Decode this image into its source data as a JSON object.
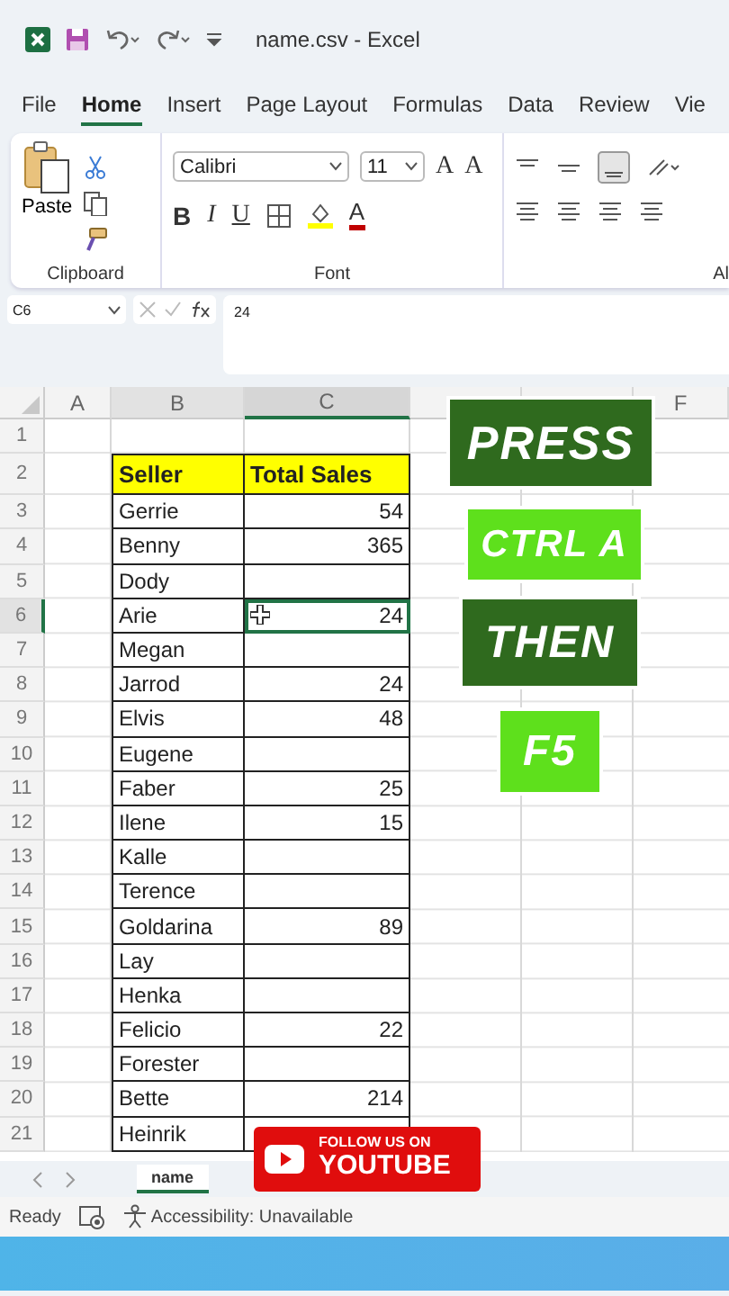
{
  "title_bar": {
    "file_name": "name.csv",
    "separator": "-",
    "app": "Excel"
  },
  "ribbon_tabs": [
    {
      "label": "File",
      "selected": false
    },
    {
      "label": "Home",
      "selected": true
    },
    {
      "label": "Insert",
      "selected": false
    },
    {
      "label": "Page Layout",
      "selected": false
    },
    {
      "label": "Formulas",
      "selected": false
    },
    {
      "label": "Data",
      "selected": false
    },
    {
      "label": "Review",
      "selected": false
    },
    {
      "label": "Vie",
      "selected": false
    }
  ],
  "clipboard": {
    "paste_label": "Paste",
    "group_label": "Clipboard"
  },
  "font": {
    "font_name": "Calibri",
    "font_size": "11",
    "grow_label": "A",
    "shrink_label": "A",
    "bold_label": "B",
    "italic_label": "I",
    "underline_label": "U",
    "color_label": "A",
    "group_label": "Font"
  },
  "alignment": {
    "group_label": "Al"
  },
  "formula_bar": {
    "cell_ref": "C6",
    "value": "24"
  },
  "columns": [
    {
      "label": "A",
      "selected": false
    },
    {
      "label": "B",
      "selected": false
    },
    {
      "label": "C",
      "selected": true
    }
  ],
  "last_column": "F",
  "rows": [
    {
      "number": "1",
      "kind": "empty"
    },
    {
      "number": "2",
      "kind": "header",
      "seller": "Seller",
      "sales": "Total Sales"
    },
    {
      "number": "3",
      "kind": "data",
      "seller": "Gerrie",
      "sales": "54",
      "selected": false
    },
    {
      "number": "4",
      "kind": "data",
      "seller": "Benny",
      "sales": "365",
      "selected": false
    },
    {
      "number": "5",
      "kind": "data",
      "seller": "Dody",
      "selected": false
    },
    {
      "number": "6",
      "kind": "data",
      "seller": "Arie",
      "sales": "24",
      "selected": true
    },
    {
      "number": "7",
      "kind": "data",
      "seller": "Megan",
      "selected": false
    },
    {
      "number": "8",
      "kind": "data",
      "seller": "Jarrod",
      "sales": "24",
      "selected": false
    },
    {
      "number": "9",
      "kind": "data",
      "seller": "Elvis",
      "sales": "48",
      "selected": false
    },
    {
      "number": "10",
      "kind": "data",
      "seller": "Eugene",
      "selected": false
    },
    {
      "number": "11",
      "kind": "data",
      "seller": "Faber",
      "sales": "25",
      "selected": false
    },
    {
      "number": "12",
      "kind": "data",
      "seller": "Ilene",
      "sales": "15",
      "selected": false
    },
    {
      "number": "13",
      "kind": "data",
      "seller": "Kalle",
      "selected": false
    },
    {
      "number": "14",
      "kind": "data",
      "seller": "Terence",
      "selected": false
    },
    {
      "number": "15",
      "kind": "data",
      "seller": "Goldarina",
      "sales": "89",
      "selected": false
    },
    {
      "number": "16",
      "kind": "data",
      "seller": "Lay",
      "selected": false
    },
    {
      "number": "17",
      "kind": "data",
      "seller": "Henka",
      "selected": false
    },
    {
      "number": "18",
      "kind": "data",
      "seller": "Felicio",
      "sales": "22",
      "selected": false
    },
    {
      "number": "19",
      "kind": "data",
      "seller": "Forester",
      "selected": false
    },
    {
      "number": "20",
      "kind": "data",
      "seller": "Bette",
      "sales": "214",
      "selected": false
    },
    {
      "number": "21",
      "kind": "data",
      "seller": "Heinrik",
      "selected": false
    }
  ],
  "captions": [
    {
      "text": "PRESS",
      "color": "#2f6a1e"
    },
    {
      "text": "CTRL A",
      "color": "#5ee01c"
    },
    {
      "text": "THEN",
      "color": "#2f6a1e"
    },
    {
      "text": "F5",
      "color": "#5ee01c"
    }
  ],
  "follow_badge": {
    "line_1": "FOLLOW US ON",
    "line_2": "YOUTUBE"
  },
  "sheet_tabs": [
    {
      "label": "name",
      "selected": true
    }
  ],
  "status_bar": {
    "mode": "Ready",
    "accessibility": "Accessibility: Unavailable"
  }
}
